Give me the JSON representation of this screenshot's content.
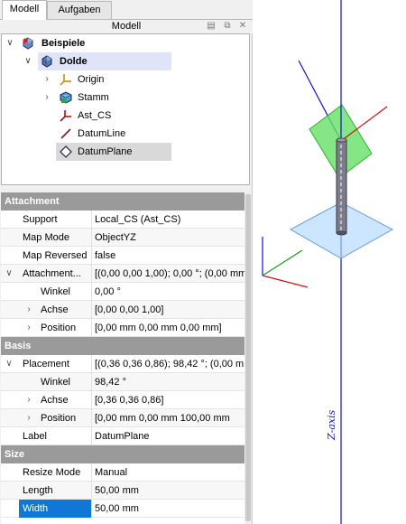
{
  "tabs": [
    {
      "label": "Modell",
      "active": true
    },
    {
      "label": "Aufgaben",
      "active": false
    }
  ],
  "model_panel": {
    "title": "Modell",
    "tree": [
      {
        "label": "Beispiele",
        "icon": "body-icon",
        "expanded": true
      },
      {
        "label": "Dolde",
        "icon": "part-icon",
        "expanded": true,
        "selected": true
      },
      {
        "label": "Origin",
        "icon": "origin-icon",
        "expanded": false
      },
      {
        "label": "Stamm",
        "icon": "body-part-icon",
        "expanded": false
      },
      {
        "label": "Ast_CS",
        "icon": "coordinate-system-icon"
      },
      {
        "label": "DatumLine",
        "icon": "datum-line-icon"
      },
      {
        "label": "DatumPlane",
        "icon": "datum-plane-icon",
        "selected": true
      }
    ]
  },
  "properties": {
    "groups": [
      {
        "name": "Attachment",
        "rows": [
          {
            "name": "Support",
            "value": "Local_CS (Ast_CS)"
          },
          {
            "name": "Map Mode",
            "value": "ObjectYZ"
          },
          {
            "name": "Map Reversed",
            "value": "false"
          },
          {
            "name": "Attachment...",
            "value": "[(0,00 0,00 1,00); 0,00 °; (0,00 mm"
          },
          {
            "name": "Winkel",
            "value": "0,00 °"
          },
          {
            "name": "Achse",
            "value": "[0,00 0,00 1,00]"
          },
          {
            "name": "Position",
            "value": "[0,00 mm  0,00 mm  0,00 mm]"
          }
        ]
      },
      {
        "name": "Basis",
        "rows": [
          {
            "name": "Placement",
            "value": "[(0,36 0,36 0,86); 98,42 °; (0,00 mm"
          },
          {
            "name": "Winkel",
            "value": "98,42 °"
          },
          {
            "name": "Achse",
            "value": "[0,36 0,36 0,86]"
          },
          {
            "name": "Position",
            "value": "[0,00 mm  0,00 mm  100,00 mm"
          },
          {
            "name": "Label",
            "value": "DatumPlane"
          }
        ]
      },
      {
        "name": "Size",
        "rows": [
          {
            "name": "Resize Mode",
            "value": "Manual"
          },
          {
            "name": "Length",
            "value": "50,00 mm"
          },
          {
            "name": "Width",
            "value": "50,00 mm"
          }
        ]
      }
    ]
  },
  "viewport": {
    "axis_label": "Z-axis"
  },
  "colors": {
    "selection_blue": "#0f78d7",
    "group_header": "#9a9a9a",
    "z_axis": "#1010d0",
    "x_axis": "#d01010",
    "y_axis": "#10a010",
    "datum_plane_green": "#66e066",
    "datum_plane_blue": "#b0d8ff"
  }
}
